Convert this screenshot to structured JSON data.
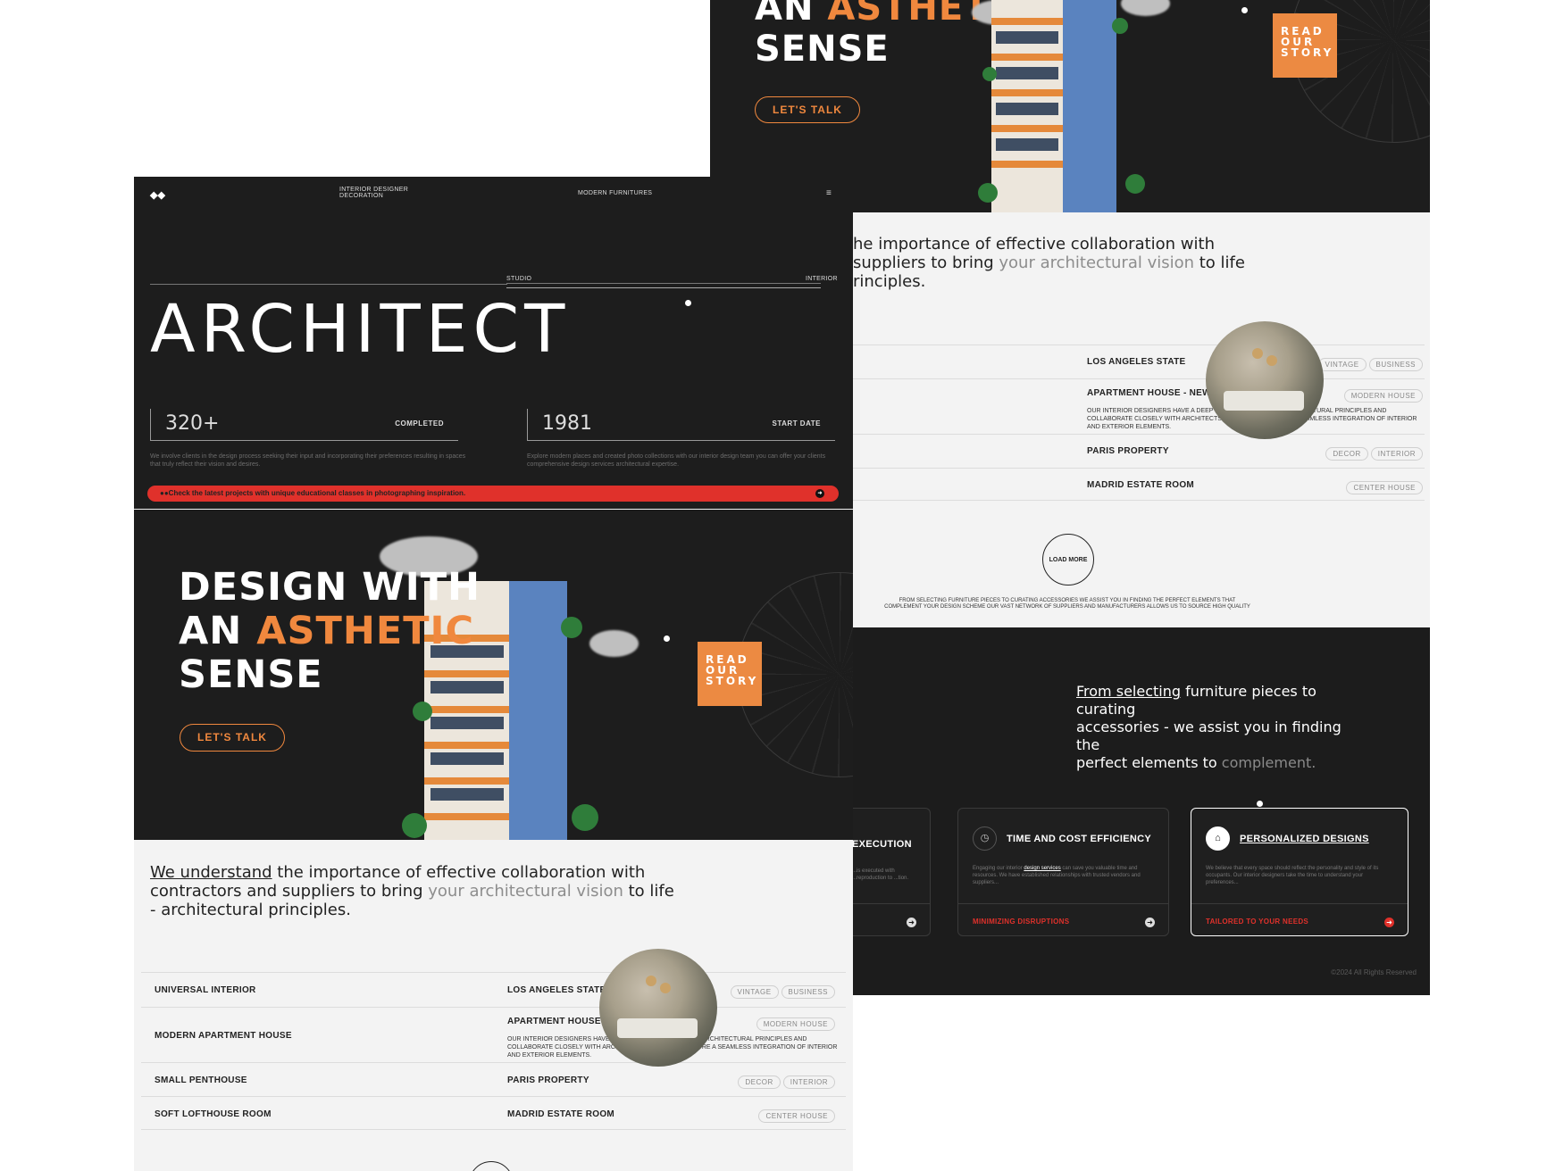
{
  "back_page": {
    "hero_heading_line2_prefix": "AN ",
    "hero_heading_line2_accent": "ASTHETIC",
    "hero_heading_line3": "SENSE",
    "lets_talk_label": "LET'S TALK",
    "read_story_lines": [
      "READ",
      "OUR",
      "STORY"
    ],
    "intro_part1": "he importance of effective collaboration with",
    "intro_part2": "suppliers to bring ",
    "intro_muted": "your architectural vision",
    "intro_part3": " to life",
    "intro_part4": "rinciples.",
    "projects": [
      {
        "name": "LOS ANGELES STATE",
        "tags": [
          "VINTAGE",
          "BUSINESS"
        ]
      },
      {
        "name": "APARTMENT HOUSE - NEW YORK",
        "tags": [
          "MODERN HOUSE"
        ],
        "desc": "OUR INTERIOR DESIGNERS HAVE A DEEP UNDERSTANDING OF ARCHITECTURAL PRINCIPLES AND COLLABORATE CLOSELY WITH ARCHITECTS LIKE YOU TO ENSURE A SEAMLESS INTEGRATION OF INTERIOR AND EXTERIOR ELEMENTS."
      },
      {
        "name": "PARIS PROPERTY",
        "tags": [
          "DECOR",
          "INTERIOR"
        ]
      },
      {
        "name": "MADRID ESTATE ROOM",
        "tags": [
          "CENTER HOUSE"
        ]
      }
    ],
    "load_more_label": "LOAD MORE",
    "footer_caption_line1": "FROM SELECTING FURNITURE PIECES TO CURATING ACCESSORIES  WE ASSIST YOU IN FINDING THE PERFECT ELEMENTS THAT",
    "footer_caption_line2": "COMPLEMENT YOUR DESIGN SCHEME  OUR VAST NETWORK OF SUPPLIERS AND MANUFACTURERS ALLOWS US TO SOURCE HIGH  QUALITY",
    "quote_link": "From selecting",
    "quote_part1": " furniture pieces to curating",
    "quote_part2": "accessories - we assist you in finding the",
    "quote_part3": "perfect elements to ",
    "quote_muted": "complement.",
    "services": [
      {
        "title": "EXECUTION",
        "desc": "...is executed with ...reproduction to ...tion.",
        "link": "",
        "icon": "clock-icon"
      },
      {
        "title": "TIME AND COST EFFICIENCY",
        "desc_pre": "Engaging our interior ",
        "desc_link": "design services",
        "desc_post": " can save you valuable time and resources. We have established relationships with trusted vendors and suppliers...",
        "link": "MINIMIZING DISRUPTIONS",
        "icon": "clock-icon"
      },
      {
        "title": "PERSONALIZED DESIGNS",
        "desc": "We believe that every space should reflect the personality and style of its occupants. Our interior designers take the time to understand your preferences...",
        "link": "TAILORED TO YOUR NEEDS",
        "icon": "home-icon"
      }
    ],
    "copyright": "©2024 All Rights Reserved"
  },
  "front_page": {
    "nav": {
      "left_line1": "INTERIOR DESIGNER",
      "left_line2": "DECORATION",
      "center": "MODERN FURNITURES"
    },
    "label_studio": "STUDIO",
    "label_interior": "INTERIOR",
    "headline": "ARCHITECT",
    "stats": [
      {
        "value": "320+",
        "label": "COMPLETED",
        "desc": "We involve clients in the design process seeking their input and incorporating their preferences resulting in spaces that truly reflect their vision and desires."
      },
      {
        "value": "1981",
        "label": "START DATE",
        "desc": "Explore modern places and created photo collections with our interior design team you can offer your clients comprehensive design services architectural expertise."
      }
    ],
    "banner_text": "Check the latest projects with unique educational classes in photographing inspiration.",
    "hero_line1": "DESIGN WITH",
    "hero_line2_prefix": "AN ",
    "hero_line2_accent": "ASTHETIC",
    "hero_line3": "SENSE",
    "lets_talk_label": "LET'S TALK",
    "read_story_lines": [
      "READ",
      "OUR",
      "STORY"
    ],
    "intro_link": "We understand",
    "intro_part1": " the importance of effective collaboration with",
    "intro_part2": "contractors and suppliers to bring ",
    "intro_muted": "your architectural vision",
    "intro_part3": " to life",
    "intro_part4": "- architectural principles.",
    "projects": [
      {
        "category": "UNIVERSAL INTERIOR",
        "name": "LOS ANGELES STATE",
        "tags": [
          "VINTAGE",
          "BUSINESS"
        ]
      },
      {
        "category": "MODERN APARTMENT HOUSE",
        "name": "APARTMENT HOUSE - NEW YORK",
        "tags": [
          "MODERN HOUSE"
        ],
        "desc": "OUR INTERIOR DESIGNERS HAVE A DEEP UNDERSTANDING OF ARCHITECTURAL PRINCIPLES AND COLLABORATE CLOSELY WITH ARCHITECTS LIKE YOU TO ENSURE A SEAMLESS INTEGRATION OF INTERIOR AND EXTERIOR ELEMENTS."
      },
      {
        "category": "SMALL PENTHOUSE",
        "name": "PARIS PROPERTY",
        "tags": [
          "DECOR",
          "INTERIOR"
        ]
      },
      {
        "category": "SOFT LOFTHOUSE ROOM",
        "name": "MADRID ESTATE ROOM",
        "tags": [
          "CENTER HOUSE"
        ]
      }
    ]
  },
  "colors": {
    "accent_orange": "#f0883e",
    "banner_red": "#e0312b",
    "dark_bg": "#1d1d1d",
    "light_bg": "#f3f3f3"
  }
}
